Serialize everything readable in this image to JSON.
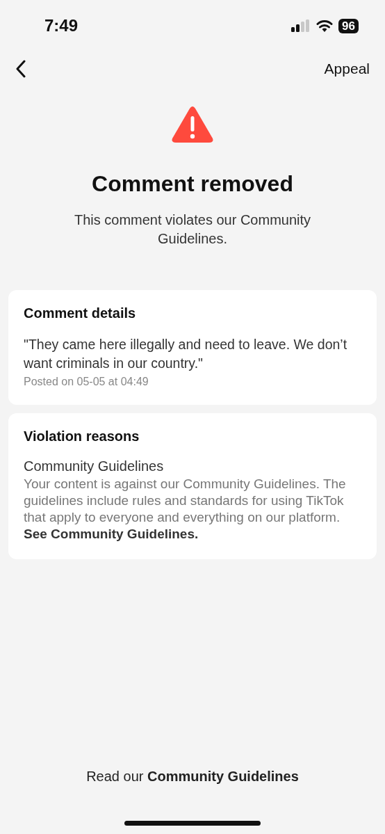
{
  "status_bar": {
    "time": "7:49",
    "battery": "96"
  },
  "nav": {
    "action": "Appeal"
  },
  "header": {
    "title": "Comment removed",
    "subtitle": "This comment violates our Community Guidelines."
  },
  "cards": [
    {
      "kind": "comment",
      "heading": "Comment details",
      "body": "\"They came here illegally and need to leave. We don’t want criminals in our country.\"",
      "meta": "Posted on 05-05 at 04:49"
    },
    {
      "kind": "reasons",
      "heading": "Violation reasons",
      "reason_title": "Community Guidelines",
      "body": "Your content is against our Community Guidelines. The guidelines include rules and standards for using TikTok that apply to everyone and everything on our platform.",
      "link": "See Community Guidelines."
    }
  ],
  "footer": {
    "text": "Read our **Community Guidelines**"
  }
}
